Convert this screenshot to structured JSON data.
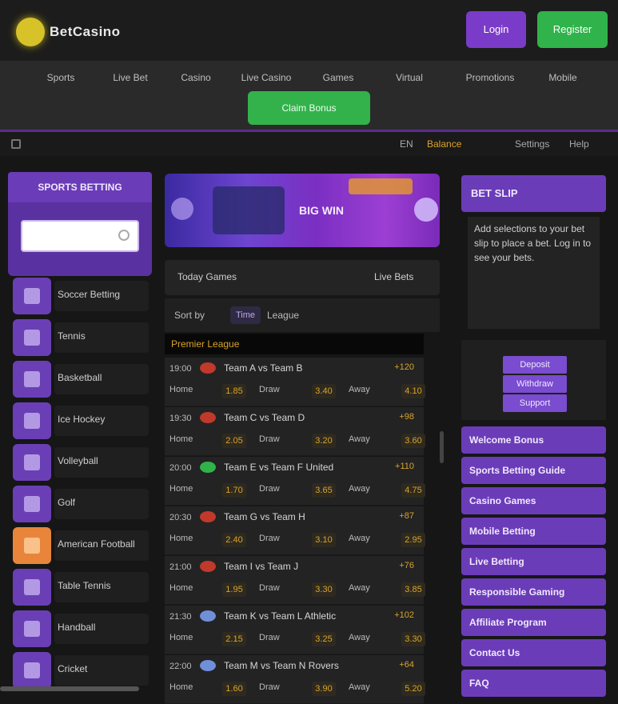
{
  "header": {
    "logo_text": "BetCasino",
    "login_label": "Login",
    "register_label": "Register"
  },
  "nav": {
    "items": [
      "Sports",
      "Live Bet",
      "Casino",
      "Live Casino",
      "Games",
      "Virtual",
      "Promotions",
      "Mobile"
    ],
    "cta_label": "Claim Bonus"
  },
  "status": {
    "a": "EN",
    "b": "Balance",
    "c": "Settings",
    "d": "Help"
  },
  "left": {
    "title": "SPORTS BETTING",
    "search_placeholder": "",
    "categories": [
      {
        "label": "Soccer Betting",
        "icon": "soccer-ball-icon"
      },
      {
        "label": "Tennis",
        "icon": "tennis-icon"
      },
      {
        "label": "Basketball",
        "icon": "basketball-icon"
      },
      {
        "label": "Ice Hockey",
        "icon": "hockey-icon"
      },
      {
        "label": "Volleyball",
        "icon": "volleyball-icon"
      },
      {
        "label": "Golf",
        "icon": "golf-icon"
      },
      {
        "label": "American Football",
        "icon": "football-icon",
        "highlight": true
      },
      {
        "label": "Table Tennis",
        "icon": "table-tennis-icon"
      },
      {
        "label": "Handball",
        "icon": "handball-icon"
      },
      {
        "label": "Cricket",
        "icon": "cricket-icon"
      }
    ]
  },
  "center": {
    "banner_text": "BIG WIN",
    "tabs": {
      "left": "Today Games",
      "right": "Live Bets"
    },
    "sort": {
      "label": "Sort by",
      "chip": "Time",
      "right": "League"
    },
    "league_label": "Premier League",
    "matches": [
      {
        "time": "19:00",
        "flag": "#c0392b",
        "name": "Team A vs Team B",
        "more": "+120",
        "odds": [
          {
            "l": "Home",
            "v": "1.85"
          },
          {
            "l": "Draw",
            "v": "3.40"
          },
          {
            "l": "Away",
            "v": "4.10"
          }
        ]
      },
      {
        "time": "19:30",
        "flag": "#c0392b",
        "name": "Team C vs Team D",
        "more": "+98",
        "odds": [
          {
            "l": "Home",
            "v": "2.05"
          },
          {
            "l": "Draw",
            "v": "3.20"
          },
          {
            "l": "Away",
            "v": "3.60"
          }
        ]
      },
      {
        "time": "20:00",
        "flag": "#2fb34a",
        "name": "Team E vs Team F United",
        "more": "+110",
        "odds": [
          {
            "l": "Home",
            "v": "1.70"
          },
          {
            "l": "Draw",
            "v": "3.65"
          },
          {
            "l": "Away",
            "v": "4.75"
          }
        ]
      },
      {
        "time": "20:30",
        "flag": "#c0392b",
        "name": "Team G vs Team H",
        "more": "+87",
        "odds": [
          {
            "l": "Home",
            "v": "2.40"
          },
          {
            "l": "Draw",
            "v": "3.10"
          },
          {
            "l": "Away",
            "v": "2.95"
          }
        ]
      },
      {
        "time": "21:00",
        "flag": "#c0392b",
        "name": "Team I vs Team J",
        "more": "+76",
        "odds": [
          {
            "l": "Home",
            "v": "1.95"
          },
          {
            "l": "Draw",
            "v": "3.30"
          },
          {
            "l": "Away",
            "v": "3.85"
          }
        ]
      },
      {
        "time": "21:30",
        "flag": "#6f8fd8",
        "name": "Team K vs Team L Athletic",
        "more": "+102",
        "odds": [
          {
            "l": "Home",
            "v": "2.15"
          },
          {
            "l": "Draw",
            "v": "3.25"
          },
          {
            "l": "Away",
            "v": "3.30"
          }
        ]
      },
      {
        "time": "22:00",
        "flag": "#6f8fd8",
        "name": "Team M vs Team N Rovers",
        "more": "+64",
        "odds": [
          {
            "l": "Home",
            "v": "1.60"
          },
          {
            "l": "Draw",
            "v": "3.90"
          },
          {
            "l": "Away",
            "v": "5.20"
          }
        ]
      }
    ]
  },
  "right": {
    "title": "BET SLIP",
    "info": "Add selections to your bet slip to place a bet. Log in to see your bets.",
    "ctas": [
      "Deposit",
      "Withdraw",
      "Support"
    ],
    "links": [
      "Welcome Bonus",
      "Sports Betting Guide",
      "Casino Games",
      "Mobile Betting",
      "Live Betting",
      "Responsible Gaming",
      "Affiliate Program",
      "Contact Us",
      "FAQ"
    ]
  }
}
